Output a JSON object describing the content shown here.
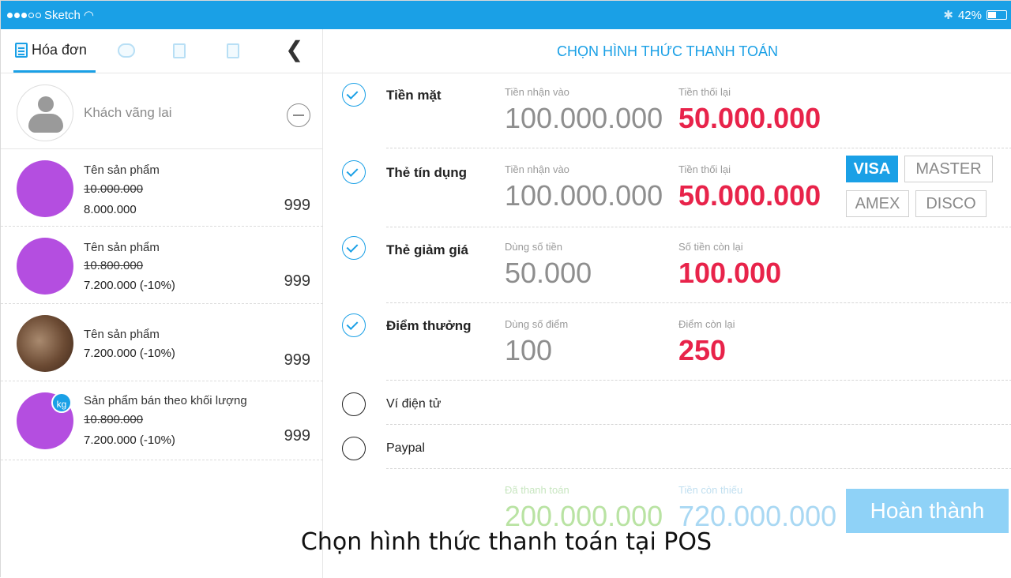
{
  "statusbar": {
    "carrier": "Sketch",
    "battery": "42%"
  },
  "left": {
    "tab_label": "Hóa đơn",
    "customer": "Khách vãng lai",
    "products": [
      {
        "name": "Tên sản phẩm",
        "old_price": "10.000.000",
        "price": "8.000.000",
        "qty": "999"
      },
      {
        "name": "Tên sản phẩm",
        "old_price": "10.800.000",
        "price": "7.200.000 (-10%)",
        "qty": "999"
      },
      {
        "name": "Tên sản phẩm",
        "price": "7.200.000 (-10%)",
        "qty": "999"
      },
      {
        "name": "Sản phẩm bán theo khối lượng",
        "badge": "kg",
        "old_price": "10.800.000",
        "price": "7.200.000 (-10%)",
        "qty": "999"
      }
    ]
  },
  "right": {
    "title": "CHỌN HÌNH THỨC THANH TOÁN",
    "methods": [
      {
        "label": "Tiền mặt",
        "cap1": "Tiền nhận vào",
        "val1": "100.000.000",
        "cap2": "Tiền thối lại",
        "val2": "50.000.000"
      },
      {
        "label": "Thẻ tín dụng",
        "cap1": "Tiền nhận vào",
        "val1": "100.000.000",
        "cap2": "Tiền thối lại",
        "val2": "50.000.000",
        "cards": [
          "VISA",
          "MASTER",
          "AMEX",
          "DISCO"
        ]
      },
      {
        "label": "Thẻ giảm giá",
        "cap1": "Dùng số tiền",
        "val1": "50.000",
        "cap2": "Số tiền còn lại",
        "val2": "100.000"
      },
      {
        "label": "Điểm thưởng",
        "cap1": "Dùng số điểm",
        "val1": "100",
        "cap2": "Điểm còn lại",
        "val2": "250"
      },
      {
        "label": "Ví điện tử"
      },
      {
        "label": "Paypal"
      }
    ],
    "footer": {
      "cap1": "Đã thanh toán",
      "val1": "200.000.000",
      "cap2": "Tiền còn thiếu",
      "val2": "720.000.000",
      "done": "Hoàn thành"
    }
  },
  "subtitle": "Chọn hình thức thanh toán tại POS"
}
